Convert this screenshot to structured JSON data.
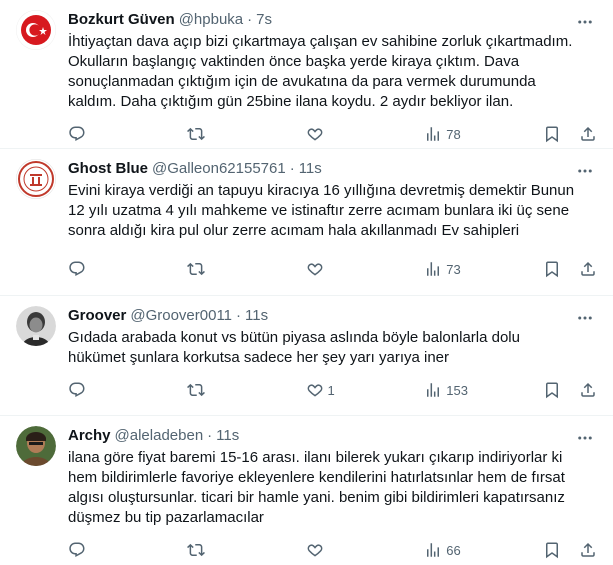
{
  "tweets": [
    {
      "name": "Bozkurt Güven",
      "handle": "@hpbuka",
      "time": "7s",
      "text": "İhtiyaçtan dava açıp bizi çıkartmaya çalışan ev sahibine zorluk çıkartmadım.\nOkulların başlangıç vaktinden önce başka yerde kiraya çıktım. Dava\nsonuçlanmadan çıktığım için de avukatına da para vermek durumunda\nkaldım. Daha çıktığım gün 25bine ilana koydu. 2 aydır bekliyor ilan.",
      "replies": "",
      "retweets": "",
      "likes": "",
      "views": "78",
      "avatar_color": "#d7191f"
    },
    {
      "name": "Ghost Blue",
      "handle": "@Galleon62155761",
      "time": "11s",
      "text": "Evini kiraya verdiği an tapuyu kiracıya 16 yıllığına devretmiş demektir Bunun\n12 yılı uzatma 4 yılı mahkeme ve istinaftır zerre acımam bunlara iki üç sene\nsonra aldığı kira pul olur zerre acımam hala akıllanmadı Ev sahipleri",
      "replies": "",
      "retweets": "",
      "likes": "",
      "views": "73",
      "avatar_color": "#c0392b"
    },
    {
      "name": "Groover",
      "handle": "@Groover0011",
      "time": "11s",
      "text": "Gıdada arabada konut vs bütün piyasa aslında böyle balonlarla dolu\nhükümet şunlara korkutsa sadece her şey yarı yarıya iner",
      "replies": "",
      "retweets": "",
      "likes": "1",
      "views": "153",
      "avatar_color": "#555555"
    },
    {
      "name": "Archy",
      "handle": "@aleladeben",
      "time": "11s",
      "text": "ilana göre fiyat baremi 15-16 arası. ilanı bilerek yukarı çıkarıp indiriyorlar ki\nhem bildirimlerle favoriye ekleyenlere kendilerini hatırlatsınlar hem de fırsat\nalgısı oluştursunlar. ticari bir hamle yani. benim gibi bildirimleri kapatırsanız\ndüşmez bu tip pazarlamacılar",
      "replies": "",
      "retweets": "",
      "likes": "",
      "views": "66",
      "avatar_color": "#6b4a2e"
    }
  ],
  "colors": {
    "text": "#0f1419",
    "muted": "#536471",
    "divider": "#eff3f4"
  },
  "icons": [
    "more-icon",
    "reply-icon",
    "retweet-icon",
    "like-icon",
    "views-icon",
    "bookmark-icon",
    "share-icon"
  ]
}
